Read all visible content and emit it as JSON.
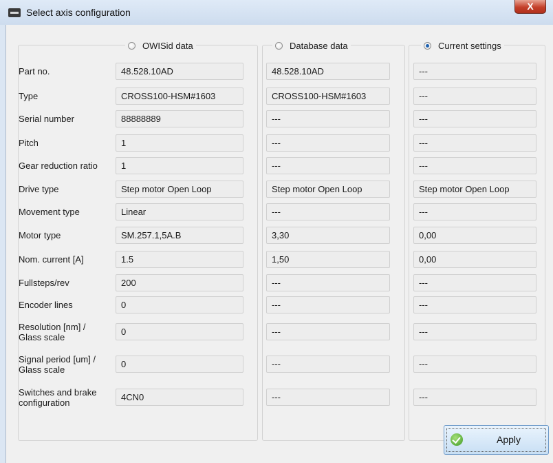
{
  "window": {
    "title": "Select axis configuration",
    "close_glyph": "X"
  },
  "columns": [
    {
      "title": "OWISid data",
      "selected": false
    },
    {
      "title": "Database data",
      "selected": false
    },
    {
      "title": "Current settings",
      "selected": true
    }
  ],
  "rows": [
    {
      "label": "Part no.",
      "values": [
        "48.528.10AD",
        "48.528.10AD",
        "---"
      ]
    },
    {
      "label": "Type",
      "values": [
        "CROSS100-HSM#1603",
        "CROSS100-HSM#1603",
        "---"
      ]
    },
    {
      "label": "Serial number",
      "values": [
        "88888889",
        "---",
        "---"
      ]
    },
    {
      "label": "Pitch",
      "values": [
        "1",
        "---",
        "---"
      ]
    },
    {
      "label": "Gear reduction ratio",
      "values": [
        "1",
        "---",
        "---"
      ]
    },
    {
      "label": "Drive type",
      "values": [
        "Step motor Open Loop",
        "Step motor Open Loop",
        "Step motor Open Loop"
      ]
    },
    {
      "label": "Movement type",
      "values": [
        "Linear",
        "---",
        "---"
      ]
    },
    {
      "label": "Motor type",
      "values": [
        "SM.257.1,5A.B",
        "3,30",
        "0,00"
      ]
    },
    {
      "label": "Nom. current [A]",
      "values": [
        "1.5",
        "1,50",
        "0,00"
      ]
    },
    {
      "label": "Fullsteps/rev",
      "values": [
        "200",
        "---",
        "---"
      ]
    },
    {
      "label": "Encoder lines",
      "values": [
        "0",
        "---",
        "---"
      ]
    },
    {
      "label": [
        "Resolution [nm] /",
        "Glass scale"
      ],
      "values": [
        "0",
        "---",
        "---"
      ]
    },
    {
      "label": [
        "Signal period [um] /",
        "Glass scale"
      ],
      "values": [
        "0",
        "---",
        "---"
      ]
    },
    {
      "label": [
        "Switches and brake",
        "configuration"
      ],
      "values": [
        "4CN0",
        "---",
        "---"
      ]
    }
  ],
  "apply": {
    "label": "Apply",
    "icon": "check-icon"
  },
  "colors": {
    "accent": "#1f62b0",
    "close": "#c4402a",
    "confirm": "#3f9a24"
  }
}
